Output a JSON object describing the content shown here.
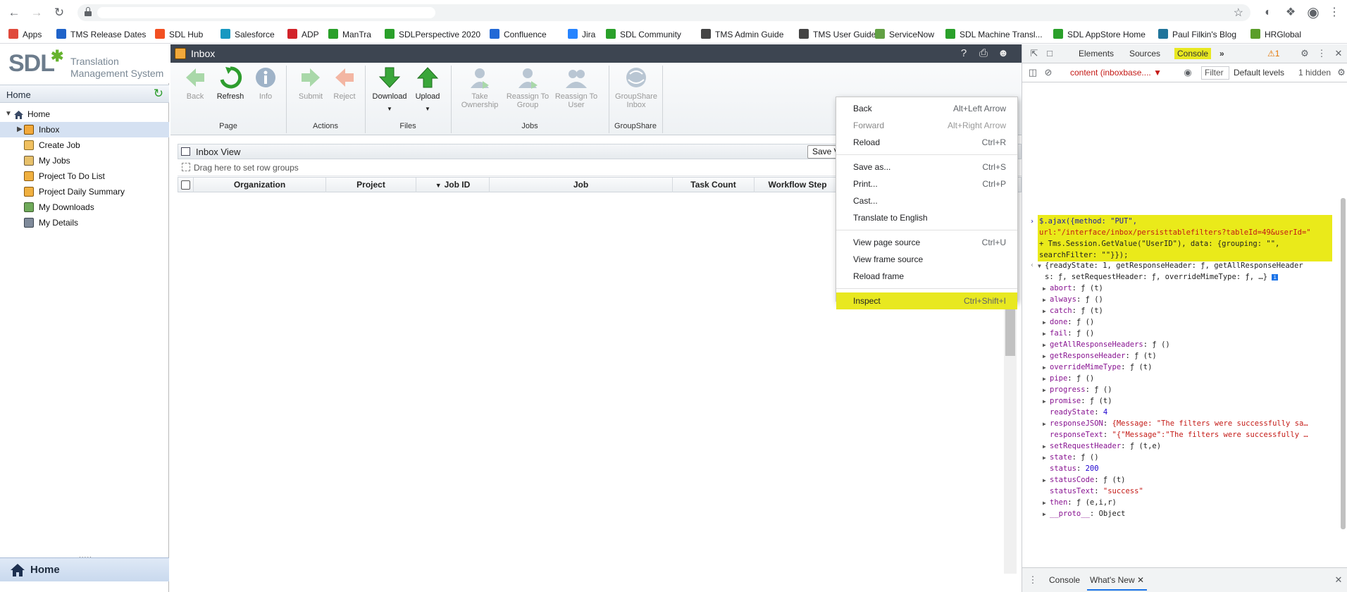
{
  "browser": {
    "bookmarks": [
      "Apps",
      "TMS Release Dates",
      "SDL Hub",
      "Salesforce",
      "ADP",
      "ManTra",
      "SDLPerspective 2020",
      "Confluence",
      "Jira",
      "SDL Community",
      "TMS Admin Guide",
      "TMS User Guide",
      "ServiceNow",
      "SDL Machine Transl...",
      "SDL AppStore Home",
      "Paul Filkin's Blog",
      "HRGlobal"
    ],
    "bookmark_colors": [
      "#e04a3c",
      "#1f63c9",
      "#f25022",
      "#1798c1",
      "#d2232a",
      "#2aa02a",
      "#2aa02a",
      "#2269d6",
      "#2684ff",
      "#2aa02a",
      "#444444",
      "#444444",
      "#62a044",
      "#2aa02a",
      "#2aa02a",
      "#21759b",
      "#5b9e2a"
    ]
  },
  "sidebar": {
    "logo_text": "SDL",
    "logo_line1": "Translation",
    "logo_line2": "Management System",
    "home_label": "Home",
    "tree_root": "Home",
    "items": [
      {
        "label": "Inbox"
      },
      {
        "label": "Create Job"
      },
      {
        "label": "My Jobs"
      },
      {
        "label": "Project To Do List"
      },
      {
        "label": "Project Daily Summary"
      },
      {
        "label": "My Downloads"
      },
      {
        "label": "My Details"
      }
    ],
    "bottom_label": "Home"
  },
  "main": {
    "title": "Inbox",
    "ribbon": {
      "buttons": [
        "Back",
        "Refresh",
        "Info",
        "Submit",
        "Reject",
        "Download",
        "Upload",
        "Take Ownership",
        "Reassign To Group",
        "Reassign To User",
        "GroupShare Inbox"
      ],
      "groups": [
        "Page",
        "Actions",
        "Files",
        "Jobs",
        "GroupShare"
      ]
    },
    "view_title": "Inbox View",
    "save_view": "Save Vi",
    "drag_hint": "Drag here to set row groups",
    "columns": [
      "Organization",
      "Project",
      "Job ID",
      "Job",
      "Task Count",
      "Workflow Step"
    ]
  },
  "context_menu": [
    {
      "label": "Back",
      "shortcut": "Alt+Left Arrow"
    },
    {
      "label": "Forward",
      "shortcut": "Alt+Right Arrow"
    },
    {
      "label": "Reload",
      "shortcut": "Ctrl+R"
    },
    {
      "label": "Save as...",
      "shortcut": "Ctrl+S"
    },
    {
      "label": "Print...",
      "shortcut": "Ctrl+P"
    },
    {
      "label": "Cast...",
      "shortcut": ""
    },
    {
      "label": "Translate to English",
      "shortcut": ""
    },
    {
      "label": "View page source",
      "shortcut": "Ctrl+U"
    },
    {
      "label": "View frame source",
      "shortcut": ""
    },
    {
      "label": "Reload frame",
      "shortcut": ""
    },
    {
      "label": "Inspect",
      "shortcut": "Ctrl+Shift+I"
    }
  ],
  "devtools": {
    "tabs": [
      "Elements",
      "Sources",
      "Console"
    ],
    "more_tabs": "»",
    "warning_count": "1",
    "context": "content (inboxbase....",
    "filter": "Filter",
    "levels": "Default levels",
    "hidden": "1 hidden",
    "command": {
      "line1": "$.ajax({method: \"PUT\",",
      "line2": "url:\"/interface/inbox/persisttablefilters?tableId=49&userId=\"",
      "line3": "+ Tms.Session.GetValue(\"UserID\"), data: {grouping: \"\",",
      "line4": "searchFilter: \"\"}});"
    },
    "result_summary_1": "{readyState: 1, getResponseHeader: ƒ, getAllResponseHeader",
    "result_summary_2": "s: ƒ, setRequestHeader: ƒ, overrideMimeType: ƒ, …}",
    "props": [
      {
        "k": "abort",
        "v": "ƒ (t)",
        "exp": true
      },
      {
        "k": "always",
        "v": "ƒ ()",
        "exp": true
      },
      {
        "k": "catch",
        "v": "ƒ (t)",
        "exp": true
      },
      {
        "k": "done",
        "v": "ƒ ()",
        "exp": true
      },
      {
        "k": "fail",
        "v": "ƒ ()",
        "exp": true
      },
      {
        "k": "getAllResponseHeaders",
        "v": "ƒ ()",
        "exp": true
      },
      {
        "k": "getResponseHeader",
        "v": "ƒ (t)",
        "exp": true
      },
      {
        "k": "overrideMimeType",
        "v": "ƒ (t)",
        "exp": true
      },
      {
        "k": "pipe",
        "v": "ƒ ()",
        "exp": true
      },
      {
        "k": "progress",
        "v": "ƒ ()",
        "exp": true
      },
      {
        "k": "promise",
        "v": "ƒ (t)",
        "exp": true
      },
      {
        "k": "readyState",
        "v": "4",
        "exp": false
      },
      {
        "k": "responseJSON",
        "v": "{Message: \"The filters were successfully sa…",
        "exp": true
      },
      {
        "k": "responseText",
        "v": "\"{\"Message\":\"The filters were successfully …",
        "exp": false
      },
      {
        "k": "setRequestHeader",
        "v": "ƒ (t,e)",
        "exp": true
      },
      {
        "k": "state",
        "v": "ƒ ()",
        "exp": true
      },
      {
        "k": "status",
        "v": "200",
        "exp": false
      },
      {
        "k": "statusCode",
        "v": "ƒ (t)",
        "exp": true
      },
      {
        "k": "statusText",
        "v": "\"success\"",
        "exp": false
      },
      {
        "k": "then",
        "v": "ƒ (e,i,r)",
        "exp": true
      },
      {
        "k": "__proto__",
        "v": "Object",
        "exp": true
      }
    ],
    "drawer_tabs": [
      "Console",
      "What's New"
    ]
  }
}
